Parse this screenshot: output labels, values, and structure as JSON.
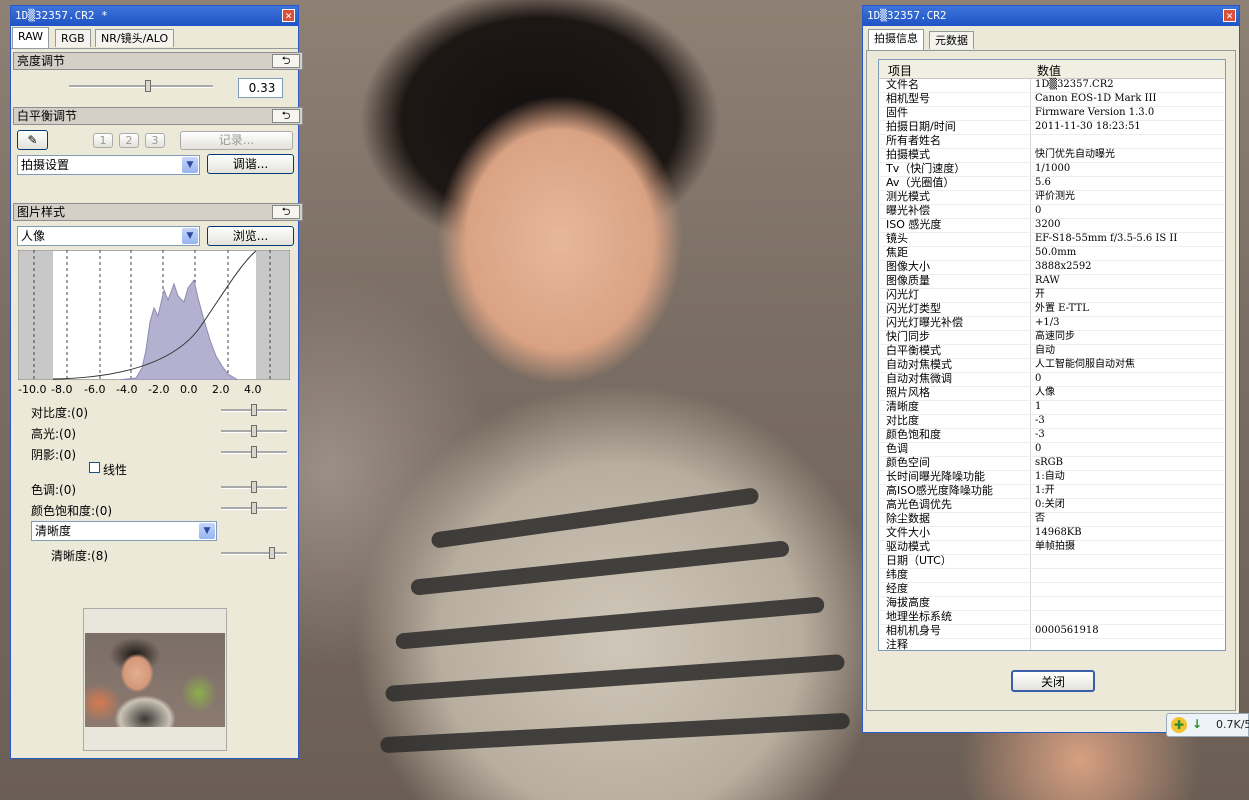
{
  "left_panel": {
    "title": "1D▒32357.CR2 *",
    "close_glyph": "✕",
    "tabs": [
      {
        "label": "RAW"
      },
      {
        "label": "RGB"
      },
      {
        "label": "NR/镜头/ALO"
      }
    ],
    "brightness": {
      "header": "亮度调节",
      "reset_glyph": "⮌",
      "value": "0.33",
      "level": 0.55
    },
    "white_balance": {
      "header": "白平衡调节",
      "reset_glyph": "⮌",
      "eyedropper_glyph": "✎",
      "presets": [
        "1",
        "2",
        "3"
      ],
      "record_label": "记录...",
      "mode": "拍摄设置",
      "adjust_label": "调谐..."
    },
    "picture_style": {
      "header": "图片样式",
      "reset_glyph": "⮌",
      "style": "人像",
      "browse_label": "浏览...",
      "histogram_ticks": [
        "-10.0",
        "-8.0",
        "-6.0",
        "-4.0",
        "-2.0",
        "0.0",
        "2.0",
        "4.0"
      ],
      "contrast": "对比度:(0)",
      "highlight": "高光:(0)",
      "shadow": "阴影:(0)",
      "linear": "线性",
      "tone": "色调:(0)",
      "saturation": "颜色饱和度:(0)",
      "sharpness_mode": "清晰度",
      "sharpness": "清晰度:(8)"
    }
  },
  "info_window": {
    "title": "1D▒32357.CR2",
    "close_glyph": "✕",
    "tabs": [
      {
        "label": "拍摄信息"
      },
      {
        "label": "元数据"
      }
    ],
    "col_item": "项目",
    "col_value": "数值",
    "rows": [
      {
        "k": "文件名",
        "v": "1D▒32357.CR2"
      },
      {
        "k": "相机型号",
        "v": "Canon EOS-1D Mark III"
      },
      {
        "k": "固件",
        "v": "Firmware Version 1.3.0"
      },
      {
        "k": "拍摄日期/时间",
        "v": "2011-11-30 18:23:51"
      },
      {
        "k": "所有者姓名",
        "v": ""
      },
      {
        "k": "拍摄模式",
        "v": "快门优先自动曝光"
      },
      {
        "k": "Tv（快门速度）",
        "v": "1/1000"
      },
      {
        "k": "Av（光圈值）",
        "v": "5.6"
      },
      {
        "k": "测光模式",
        "v": "评价测光"
      },
      {
        "k": "曝光补偿",
        "v": "0"
      },
      {
        "k": "ISO 感光度",
        "v": "3200"
      },
      {
        "k": "镜头",
        "v": "EF-S18-55mm f/3.5-5.6 IS II"
      },
      {
        "k": "焦距",
        "v": "50.0mm"
      },
      {
        "k": "图像大小",
        "v": "3888x2592"
      },
      {
        "k": "图像质量",
        "v": "RAW"
      },
      {
        "k": "闪光灯",
        "v": "开"
      },
      {
        "k": "闪光灯类型",
        "v": "外置 E-TTL"
      },
      {
        "k": "闪光灯曝光补偿",
        "v": "+1/3"
      },
      {
        "k": "快门同步",
        "v": "高速同步"
      },
      {
        "k": "白平衡模式",
        "v": "自动"
      },
      {
        "k": "自动对焦模式",
        "v": "人工智能伺服自动对焦"
      },
      {
        "k": "自动对焦微调",
        "v": "0"
      },
      {
        "k": "照片风格",
        "v": "人像"
      },
      {
        "k": "清晰度",
        "v": "1"
      },
      {
        "k": "对比度",
        "v": "-3"
      },
      {
        "k": "颜色饱和度",
        "v": "-3"
      },
      {
        "k": "色调",
        "v": "0"
      },
      {
        "k": "颜色空间",
        "v": "sRGB"
      },
      {
        "k": "长时间曝光降噪功能",
        "v": "1:自动"
      },
      {
        "k": "高ISO感光度降噪功能",
        "v": "1:开"
      },
      {
        "k": "高光色调优先",
        "v": "0:关闭"
      },
      {
        "k": "除尘数据",
        "v": "否"
      },
      {
        "k": "文件大小",
        "v": "14968KB"
      },
      {
        "k": "驱动模式",
        "v": "单帧拍摄"
      },
      {
        "k": "日期（UTC）",
        "v": ""
      },
      {
        "k": "纬度",
        "v": ""
      },
      {
        "k": "经度",
        "v": ""
      },
      {
        "k": "海拔高度",
        "v": ""
      },
      {
        "k": "地理坐标系统",
        "v": ""
      },
      {
        "k": "相机机身号",
        "v": "0000561918"
      },
      {
        "k": "注释",
        "v": ""
      },
      {
        "k": "",
        "v": ""
      },
      {
        "k": "",
        "v": ""
      },
      {
        "k": "",
        "v": ""
      }
    ],
    "close_label": "关闭"
  },
  "net_badge": {
    "speed": "0.7K/5",
    "arrow_glyph": "↓",
    "icon_glyph": "✚"
  }
}
